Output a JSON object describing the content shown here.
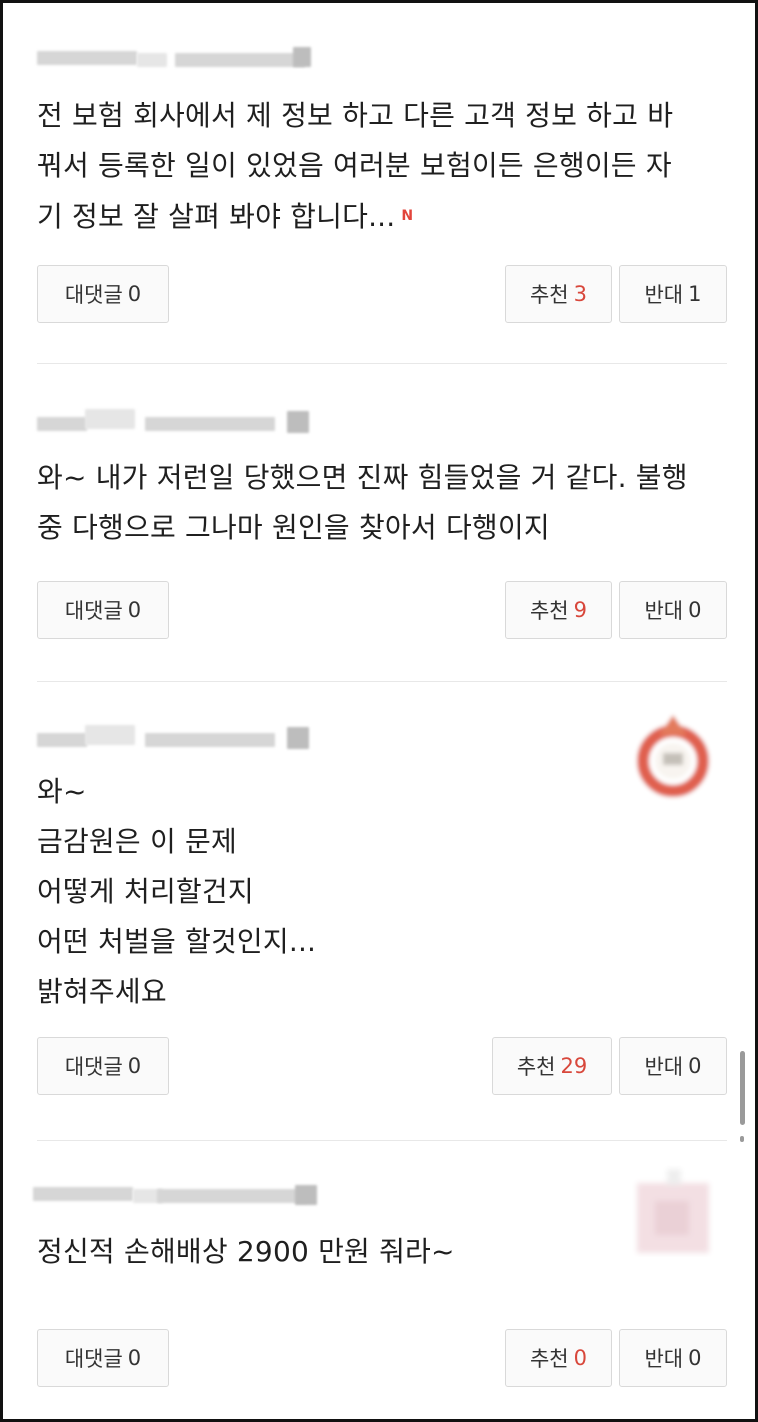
{
  "comments": [
    {
      "lines": [
        "전 보험 회사에서 제 정보 하고 다른 고객 정보 하고 바",
        "꿔서 등록한 일이 있었음 여러분 보험이든 은행이든 자",
        "기 정보 잘 살펴 봐야 합니다..."
      ],
      "new_badge": "N",
      "reply_label": "대댓글",
      "reply_count": "0",
      "up_label": "추천",
      "up_count": "3",
      "down_label": "반대",
      "down_count": "1"
    },
    {
      "lines": [
        "와~ 내가 저런일 당했으면 진짜 힘들었을 거 같다. 불행",
        "중 다행으로 그나마 원인을 찾아서 다행이지"
      ],
      "reply_label": "대댓글",
      "reply_count": "0",
      "up_label": "추천",
      "up_count": "9",
      "down_label": "반대",
      "down_count": "0"
    },
    {
      "lines": [
        "와~",
        "금감원은 이 문제",
        "어떻게 처리할건지",
        "어떤 처벌을 할것인지...",
        "밝혀주세요"
      ],
      "reply_label": "대댓글",
      "reply_count": "0",
      "up_label": "추천",
      "up_count": "29",
      "down_label": "반대",
      "down_count": "0"
    },
    {
      "lines": [
        "정신적 손해배상 2900 만원 줘라~"
      ],
      "reply_label": "대댓글",
      "reply_count": "0",
      "up_label": "추천",
      "up_count": "0",
      "down_label": "반대",
      "down_count": "0"
    }
  ],
  "colors": {
    "accent_red": "#d8473b",
    "new_badge": "#e2453c"
  }
}
